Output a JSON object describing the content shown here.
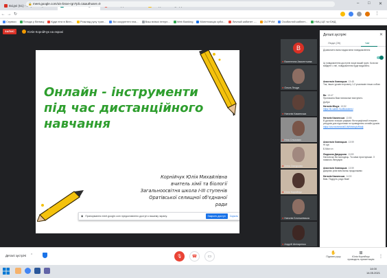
{
  "browser": {
    "tabs": [
      {
        "title": "Вхідні (51) - leaperina.t@eskabi",
        "color": "#d93025",
        "active": false
      },
      {
        "title": "Meet: \"ois-bnxe-rgn\"",
        "color": "#00897b",
        "active": true
      },
      {
        "title": "ЮЖО ВІДЕО",
        "color": "#ea4335",
        "active": false
      },
      {
        "title": "Мій диск – Google Диск",
        "color": "#fbbc04",
        "active": false
      }
    ],
    "new_tab": "+",
    "url": "meet.google.com/ois-bnxe-rgn?pli=1&authuser=0",
    "window_controls": [
      "–",
      "□",
      "✕"
    ]
  },
  "bookmarks": [
    {
      "label": "Сервіси",
      "color": "#4285f4"
    },
    {
      "label": "Погода у Вінниці",
      "color": "#34a853"
    },
    {
      "label": "Куди піти в Вінн...",
      "color": "#ea4335"
    },
    {
      "label": "Розклад руху тран...",
      "color": "#fbbc04"
    },
    {
      "label": "Всі кокурентні пла...",
      "color": "#4285f4"
    },
    {
      "label": "Ваш вхімоі інтерн...",
      "color": "#9aa0a6"
    },
    {
      "label": "Web Banking",
      "color": "#34a853"
    },
    {
      "label": "Монетизація субсі...",
      "color": "#1a73e8"
    },
    {
      "label": "Личный кабинет -...",
      "color": "#ea4335"
    },
    {
      "label": "OLTPVM",
      "color": "#f29900"
    },
    {
      "label": "Особистий кабінет...",
      "color": "#4285f4"
    },
    {
      "label": "НМЦ ЦЕ та ЄЖД",
      "color": "#34a853"
    }
  ],
  "meet": {
    "recording_badge": "ЗАПИС",
    "presenter": "Юлія Корнійчук на екрані",
    "slide": {
      "title": "Онлайн - інструменти під час дистанційного навчання",
      "author_lines": [
        "Корнійчук Юлія Михайлівна",
        "вчитель хімії та біології",
        "Загальноосвітня школа І-ІІІ ступенів",
        "Оратівської селищної об'єднаної",
        "ради"
      ]
    },
    "share_banner": {
      "text": "Прапормання meet.google.com предоставлено доступ к вашему экрану.",
      "stop_label": "Закрыть доступ",
      "hide_label": "Скрыть"
    },
    "participants": [
      {
        "name": "Валентина Авксентьєва",
        "initial": "В",
        "avatar_color": "#d93025"
      },
      {
        "name": "Ольга Лещук",
        "initial": "",
        "avatar_color": "#8d6e63"
      },
      {
        "name": "Наталія Каминська",
        "initial": "",
        "avatar_color": "#5d4037"
      },
      {
        "name": "Ніна Ольховик",
        "initial": "",
        "avatar_color": "#795548"
      },
      {
        "name": "Анна Сімчукова",
        "initial": "",
        "avatar_color": "#a1887f"
      },
      {
        "name": "Юлія Корнійчук",
        "initial": "",
        "avatar_color": "#4e342e"
      },
      {
        "name": "Наталія Блоншевська",
        "initial": "",
        "avatar_color": "#8d6e63"
      },
      {
        "name": "Андрій Шлігаренко",
        "initial": "",
        "avatar_color": "#3e2723"
      }
    ]
  },
  "chat_panel": {
    "title": "Деталі зустрічі",
    "close": "✕",
    "tabs": {
      "people": "Люди (26)",
      "chat": "Чат"
    },
    "allow_text": "Дозволити всім надсилати повідомлення",
    "info_text": "Ці повідомлення доступні лише вашій групі. Коли ви вийдете з неї, повідомлення буде видалено.",
    "messages": [
      {
        "sender": "Анастасія Ковнацька",
        "time": "13:48",
        "text": "Так, інших уроків в проєкту 1-2 учасників тільки собою"
      },
      {
        "sender": "Ви",
        "time": "13:47",
        "text": "Прописана Вам натисклые виступить"
      },
      {
        "sender": "",
        "time": "",
        "text": "Добре"
      },
      {
        "sender": "Наталія Міщук",
        "time": "13:52",
        "text": "",
        "link": "https://lk.sabeb.SudBukddmsI"
      },
      {
        "sender": "Наталія Каминська",
        "time": "13:55",
        "text": "В дальних в вашіх рафіках Фотографічний інтернет-ресурсів для підготовки та проведення онлайн-уроків:",
        "link": "https://drv.me/entnkttG1NfNhhbqfoRdafj"
      },
      {
        "sender": "Анастасія Ковнацька",
        "time": "13:59",
        "text": "Hi ща"
      },
      {
        "sender": "",
        "time": "",
        "text": "Б.Мал.т.н"
      },
      {
        "sender": "Людмила Дмідорова",
        "time": "13:59",
        "text": "Наталочко Ви молодець. Та сама просторішки. З повагою Ліннуарів"
      },
      {
        "sender": "Анастасія Ковнацька",
        "time": "13:59",
        "text": "Дякуємо усім всім вальк продолжимо"
      },
      {
        "sender": "Наталія Каминська",
        "time": "14:00",
        "text": "Вам. Подруга, радо Вам!"
      }
    ],
    "input_placeholder": "Надіслати усім повідомлення"
  },
  "bottom_bar": {
    "details_label": "Деталі зустрічі",
    "raise_hand_label": "Підняти руку",
    "presenting_label": "Юлія Корнійчук проводить презентацію"
  },
  "taskbar": {
    "time": "14:00",
    "date": "14.05.2021"
  }
}
